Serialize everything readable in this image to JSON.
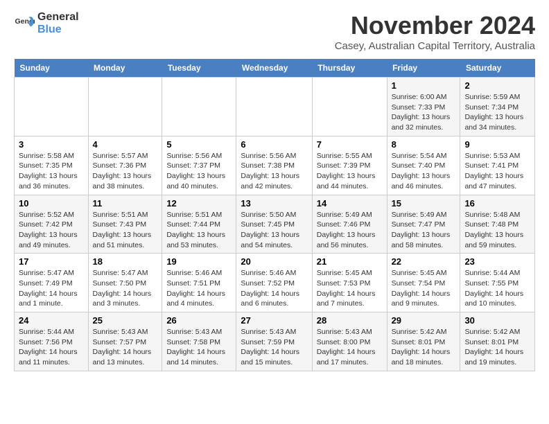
{
  "header": {
    "logo_general": "General",
    "logo_blue": "Blue",
    "month_title": "November 2024",
    "location": "Casey, Australian Capital Territory, Australia"
  },
  "calendar": {
    "days_of_week": [
      "Sunday",
      "Monday",
      "Tuesday",
      "Wednesday",
      "Thursday",
      "Friday",
      "Saturday"
    ],
    "weeks": [
      [
        {
          "day": "",
          "detail": ""
        },
        {
          "day": "",
          "detail": ""
        },
        {
          "day": "",
          "detail": ""
        },
        {
          "day": "",
          "detail": ""
        },
        {
          "day": "",
          "detail": ""
        },
        {
          "day": "1",
          "detail": "Sunrise: 6:00 AM\nSunset: 7:33 PM\nDaylight: 13 hours\nand 32 minutes."
        },
        {
          "day": "2",
          "detail": "Sunrise: 5:59 AM\nSunset: 7:34 PM\nDaylight: 13 hours\nand 34 minutes."
        }
      ],
      [
        {
          "day": "3",
          "detail": "Sunrise: 5:58 AM\nSunset: 7:35 PM\nDaylight: 13 hours\nand 36 minutes."
        },
        {
          "day": "4",
          "detail": "Sunrise: 5:57 AM\nSunset: 7:36 PM\nDaylight: 13 hours\nand 38 minutes."
        },
        {
          "day": "5",
          "detail": "Sunrise: 5:56 AM\nSunset: 7:37 PM\nDaylight: 13 hours\nand 40 minutes."
        },
        {
          "day": "6",
          "detail": "Sunrise: 5:56 AM\nSunset: 7:38 PM\nDaylight: 13 hours\nand 42 minutes."
        },
        {
          "day": "7",
          "detail": "Sunrise: 5:55 AM\nSunset: 7:39 PM\nDaylight: 13 hours\nand 44 minutes."
        },
        {
          "day": "8",
          "detail": "Sunrise: 5:54 AM\nSunset: 7:40 PM\nDaylight: 13 hours\nand 46 minutes."
        },
        {
          "day": "9",
          "detail": "Sunrise: 5:53 AM\nSunset: 7:41 PM\nDaylight: 13 hours\nand 47 minutes."
        }
      ],
      [
        {
          "day": "10",
          "detail": "Sunrise: 5:52 AM\nSunset: 7:42 PM\nDaylight: 13 hours\nand 49 minutes."
        },
        {
          "day": "11",
          "detail": "Sunrise: 5:51 AM\nSunset: 7:43 PM\nDaylight: 13 hours\nand 51 minutes."
        },
        {
          "day": "12",
          "detail": "Sunrise: 5:51 AM\nSunset: 7:44 PM\nDaylight: 13 hours\nand 53 minutes."
        },
        {
          "day": "13",
          "detail": "Sunrise: 5:50 AM\nSunset: 7:45 PM\nDaylight: 13 hours\nand 54 minutes."
        },
        {
          "day": "14",
          "detail": "Sunrise: 5:49 AM\nSunset: 7:46 PM\nDaylight: 13 hours\nand 56 minutes."
        },
        {
          "day": "15",
          "detail": "Sunrise: 5:49 AM\nSunset: 7:47 PM\nDaylight: 13 hours\nand 58 minutes."
        },
        {
          "day": "16",
          "detail": "Sunrise: 5:48 AM\nSunset: 7:48 PM\nDaylight: 13 hours\nand 59 minutes."
        }
      ],
      [
        {
          "day": "17",
          "detail": "Sunrise: 5:47 AM\nSunset: 7:49 PM\nDaylight: 14 hours\nand 1 minute."
        },
        {
          "day": "18",
          "detail": "Sunrise: 5:47 AM\nSunset: 7:50 PM\nDaylight: 14 hours\nand 3 minutes."
        },
        {
          "day": "19",
          "detail": "Sunrise: 5:46 AM\nSunset: 7:51 PM\nDaylight: 14 hours\nand 4 minutes."
        },
        {
          "day": "20",
          "detail": "Sunrise: 5:46 AM\nSunset: 7:52 PM\nDaylight: 14 hours\nand 6 minutes."
        },
        {
          "day": "21",
          "detail": "Sunrise: 5:45 AM\nSunset: 7:53 PM\nDaylight: 14 hours\nand 7 minutes."
        },
        {
          "day": "22",
          "detail": "Sunrise: 5:45 AM\nSunset: 7:54 PM\nDaylight: 14 hours\nand 9 minutes."
        },
        {
          "day": "23",
          "detail": "Sunrise: 5:44 AM\nSunset: 7:55 PM\nDaylight: 14 hours\nand 10 minutes."
        }
      ],
      [
        {
          "day": "24",
          "detail": "Sunrise: 5:44 AM\nSunset: 7:56 PM\nDaylight: 14 hours\nand 11 minutes."
        },
        {
          "day": "25",
          "detail": "Sunrise: 5:43 AM\nSunset: 7:57 PM\nDaylight: 14 hours\nand 13 minutes."
        },
        {
          "day": "26",
          "detail": "Sunrise: 5:43 AM\nSunset: 7:58 PM\nDaylight: 14 hours\nand 14 minutes."
        },
        {
          "day": "27",
          "detail": "Sunrise: 5:43 AM\nSunset: 7:59 PM\nDaylight: 14 hours\nand 15 minutes."
        },
        {
          "day": "28",
          "detail": "Sunrise: 5:43 AM\nSunset: 8:00 PM\nDaylight: 14 hours\nand 17 minutes."
        },
        {
          "day": "29",
          "detail": "Sunrise: 5:42 AM\nSunset: 8:01 PM\nDaylight: 14 hours\nand 18 minutes."
        },
        {
          "day": "30",
          "detail": "Sunrise: 5:42 AM\nSunset: 8:01 PM\nDaylight: 14 hours\nand 19 minutes."
        }
      ]
    ]
  }
}
